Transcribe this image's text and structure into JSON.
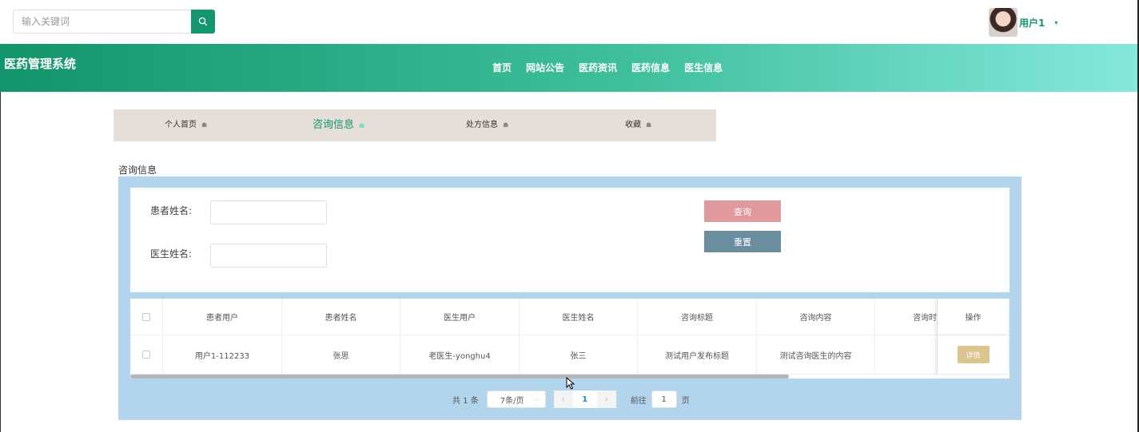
{
  "search": {
    "placeholder": "输入关键词",
    "icon": "search-icon"
  },
  "user": {
    "name": "用户1",
    "caret": "▾"
  },
  "brand": {
    "title": "医药管理系统"
  },
  "nav": {
    "items": [
      "首页",
      "网站公告",
      "医药资讯",
      "医药信息",
      "医生信息"
    ]
  },
  "submenu": {
    "items": [
      {
        "label": "个人首页",
        "active": false
      },
      {
        "label": "咨询信息",
        "active": true
      },
      {
        "label": "处方信息",
        "active": false
      },
      {
        "label": "收藏",
        "active": false
      }
    ]
  },
  "section": {
    "title": "咨询信息"
  },
  "filter": {
    "patient_label": "患者姓名:",
    "patient_value": "",
    "doctor_label": "医生姓名:",
    "doctor_value": "",
    "query_label": "查询",
    "reset_label": "重置"
  },
  "table": {
    "headers": [
      "患者用户",
      "患者姓名",
      "医生用户",
      "医生姓名",
      "咨询标题",
      "咨询内容",
      "咨询时",
      "操作"
    ],
    "rows": [
      [
        "用户1-112233",
        "张思",
        "老医生-yonghu4",
        "张三",
        "测试用户发布标题",
        "测试咨询医生的内容",
        "",
        "详情"
      ]
    ]
  },
  "pagination": {
    "total": "共 1 条",
    "page_size": "7条/页",
    "current": "1",
    "goto_label": "前往",
    "goto_value": "1",
    "page_suffix": "页"
  },
  "colors": {
    "accent": "#14966f",
    "header_start": "#13946b",
    "header_end": "#86e8dc",
    "panel": "#b2d4ec",
    "query_button": "#e0999f",
    "reset_button": "#6b8e9e",
    "detail_button": "#dcc48e"
  }
}
